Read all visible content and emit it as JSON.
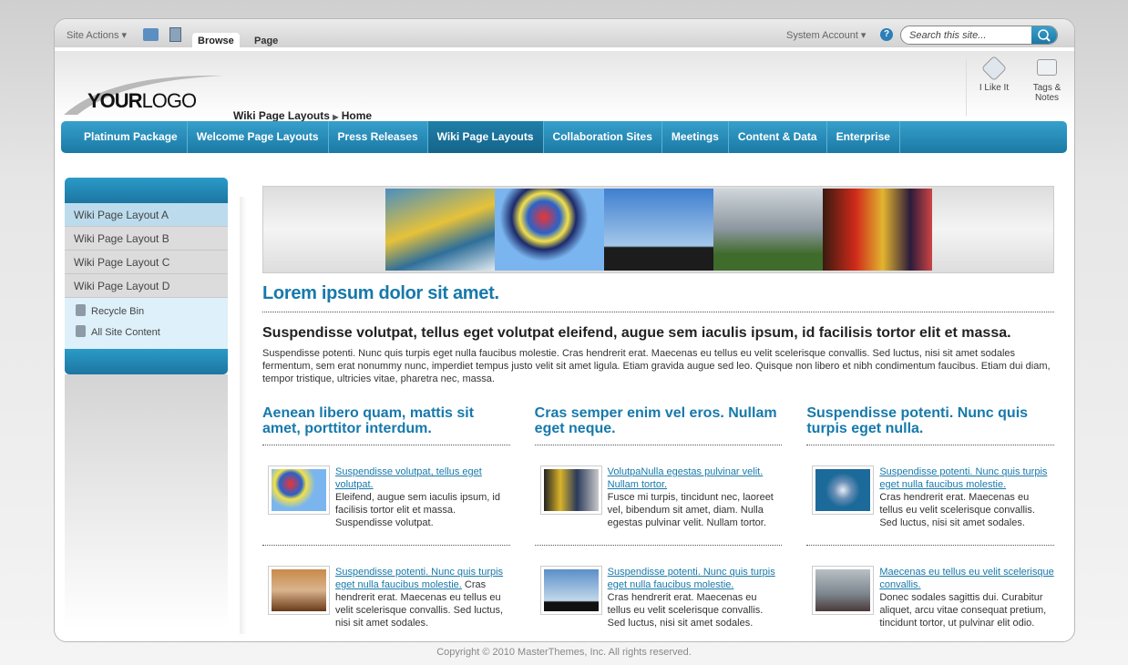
{
  "ribbon": {
    "site_actions": "Site Actions",
    "tabs": [
      "Browse",
      "Page"
    ],
    "account": "System Account",
    "search_placeholder": "Search this site..."
  },
  "header": {
    "logo_text": "YOURLOGO",
    "breadcrumb": [
      "Wiki Page Layouts",
      "Home"
    ],
    "social": [
      "I Like It",
      "Tags & Notes"
    ]
  },
  "nav": [
    "Platinum Package",
    "Welcome Page Layouts",
    "Press Releases",
    "Wiki Page Layouts",
    "Collaboration Sites",
    "Meetings",
    "Content & Data",
    "Enterprise"
  ],
  "sidebar": {
    "items": [
      "Wiki Page Layout A",
      "Wiki Page Layout B",
      "Wiki Page Layout C",
      "Wiki Page Layout D"
    ],
    "links": [
      "Recycle Bin",
      "All Site Content"
    ]
  },
  "main": {
    "title": "Lorem ipsum dolor sit amet.",
    "subtitle": "Suspendisse volutpat, tellus eget volutpat eleifend, augue sem iaculis ipsum, id facilisis tortor elit et massa.",
    "paragraph": "Suspendisse potenti. Nunc quis turpis eget nulla faucibus molestie. Cras hendrerit erat. Maecenas eu tellus eu velit scelerisque convallis. Sed luctus, nisi sit amet sodales fermentum, sem erat nonummy nunc, imperdiet tempus justo velit sit amet ligula. Etiam gravida augue sed leo. Quisque non libero et nibh condimentum faucibus. Etiam dui diam, tempor tristique, ultricies vitae, pharetra nec, massa.",
    "columns": [
      {
        "heading": "Aenean libero quam, mattis sit amet, porttitor interdum.",
        "items": [
          {
            "link": "Suspendisse volutpat, tellus eget volutpat. ",
            "text": "Eleifend, augue sem iaculis ipsum, id facilisis tortor elit et massa. Suspendisse volutpat."
          },
          {
            "link": "Suspendisse potenti. Nunc quis turpis eget nulla faucibus molestie.",
            "text": " Cras hendrerit erat. Maecenas eu tellus eu velit scelerisque convallis. Sed luctus, nisi sit amet sodales."
          }
        ]
      },
      {
        "heading": "Cras semper enim vel eros. Nullam eget neque.",
        "items": [
          {
            "link": "VolutpaNulla egestas pulvinar velit. Nullam tortor.",
            "text": "Fusce mi turpis, tincidunt nec, laoreet vel, bibendum sit amet, diam. Nulla egestas pulvinar velit. Nullam tortor."
          },
          {
            "link": "Suspendisse potenti. Nunc quis turpis eget nulla faucibus molestie.",
            "text": "Cras hendrerit erat. Maecenas eu tellus eu velit scelerisque convallis. Sed luctus, nisi sit amet sodales."
          }
        ]
      },
      {
        "heading": "Suspendisse potenti. Nunc quis turpis eget nulla.",
        "items": [
          {
            "link": "Suspendisse potenti. Nunc quis turpis eget nulla faucibus molestie.",
            "text": "Cras hendrerit erat. Maecenas eu tellus eu velit scelerisque convallis. Sed luctus, nisi sit amet sodales."
          },
          {
            "link": "Maecenas eu tellus eu velit scelerisque convallis.",
            "text": "Donec sodales sagittis dui. Curabitur aliquet, arcu vitae consequat pretium, tincidunt tortor, ut pulvinar elit odio."
          }
        ]
      }
    ]
  },
  "footer": "Copyright © 2010 MasterThemes, Inc. All rights reserved.",
  "colors": {
    "accent": "#1679ab",
    "nav": "#1f86b0"
  }
}
